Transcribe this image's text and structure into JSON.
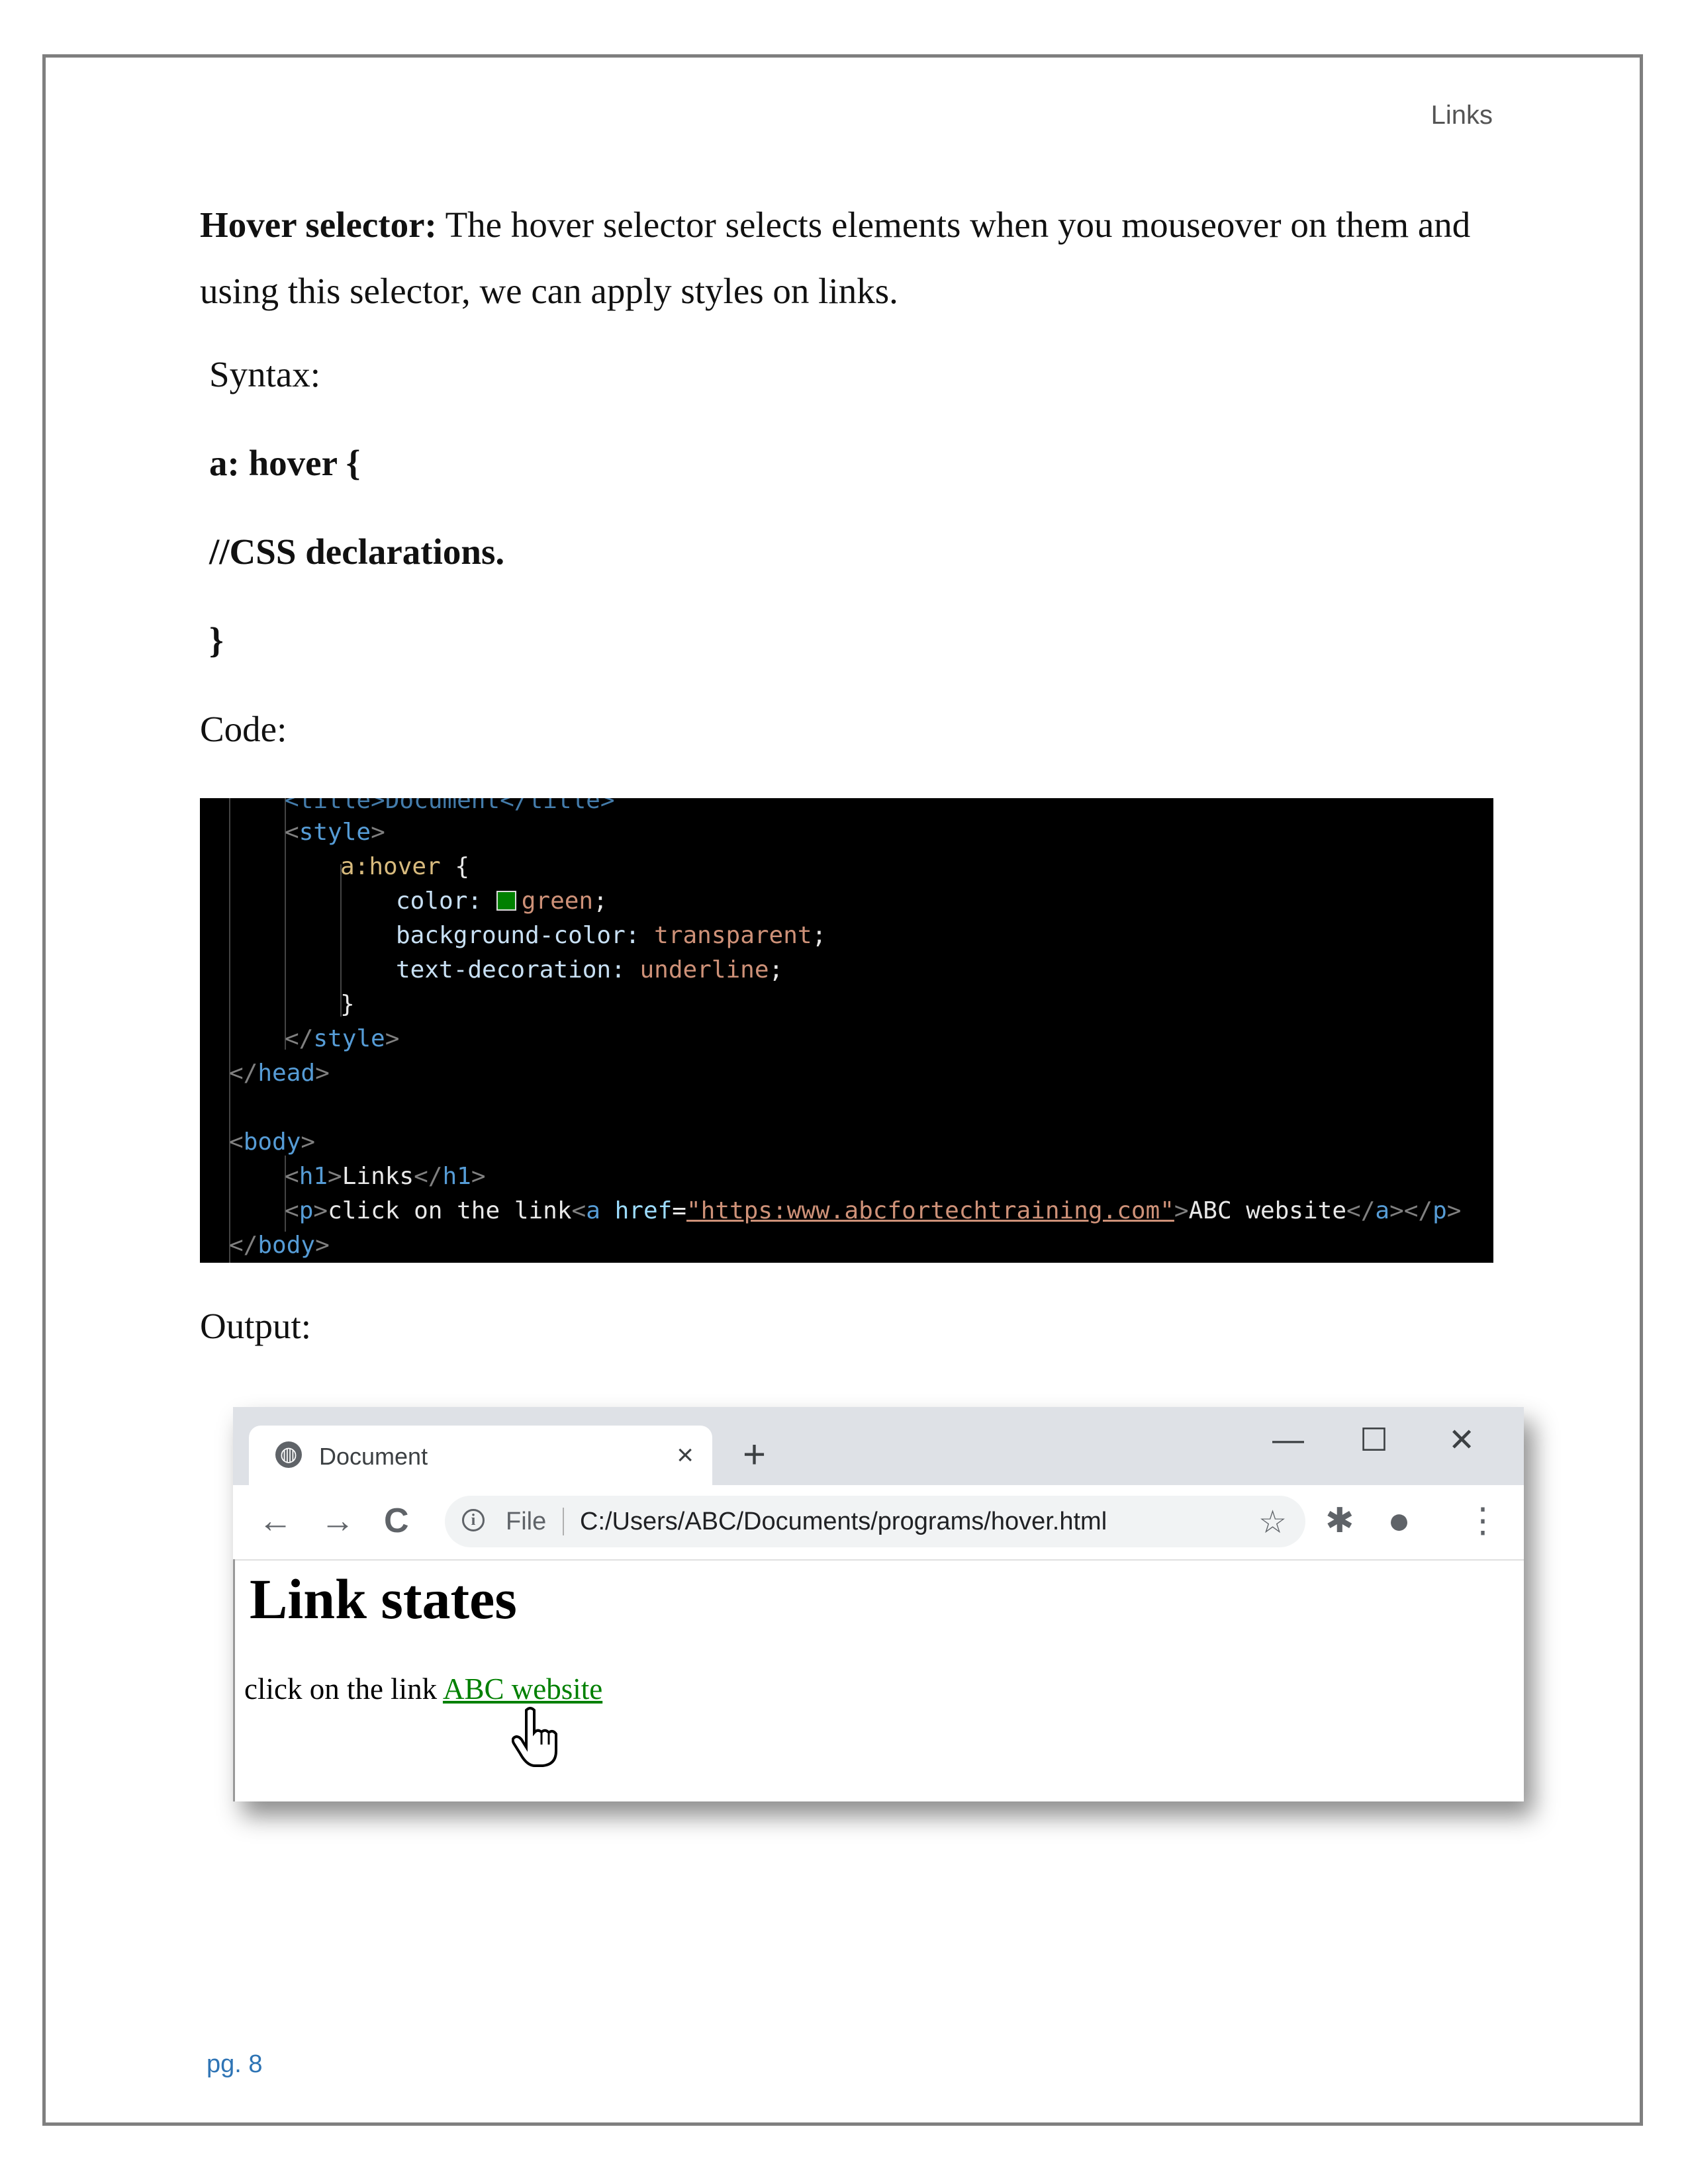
{
  "header": {
    "title": "Links"
  },
  "intro": {
    "term": "Hover selector:",
    "text": " The hover selector selects elements when you mouseover on them and using this selector, we can apply styles on links."
  },
  "syntax": {
    "label": "Syntax:",
    "line1": "a: hover {",
    "line2": "//CSS declarations.",
    "line3": "}"
  },
  "code_label": "Code:",
  "code": {
    "l0": "<title>Document</title>",
    "style_open": "style",
    "selector": "a:hover",
    "brace_open": " {",
    "prop1": "color:",
    "val1": "green",
    "prop2": "background-color:",
    "val2": "transparent",
    "prop3": "text-decoration:",
    "val3": "underline",
    "brace_close": "}",
    "style_close": "style",
    "head_close": "head",
    "body_open": "body",
    "h1_tag": "h1",
    "h1_text": "Links",
    "p_tag": "p",
    "p_text": "click on the link",
    "a_tag": "a",
    "href_attr": "href",
    "href_value": "\"https:www.abcfortechtraining.com\"",
    "a_text": "ABC website",
    "body_close": "body",
    "swatch_color": "#008000"
  },
  "output_label": "Output:",
  "browser": {
    "tab_title": "Document",
    "tab_close": "×",
    "new_tab": "+",
    "minimize": "—",
    "maximize": "☐",
    "close": "✕",
    "back": "←",
    "forward": "→",
    "reload": "C",
    "info": "i",
    "file_label": "File",
    "url": "C:/Users/ABC/Documents/programs/hover.html",
    "bookmark": "☆",
    "extensions": "✱",
    "profile": "●",
    "menu": "⋮",
    "page_heading": "Link states",
    "page_text": "click on the link ",
    "page_link": "ABC website",
    "link_color": "#008000"
  },
  "footer": {
    "page_number": "pg. 8"
  }
}
